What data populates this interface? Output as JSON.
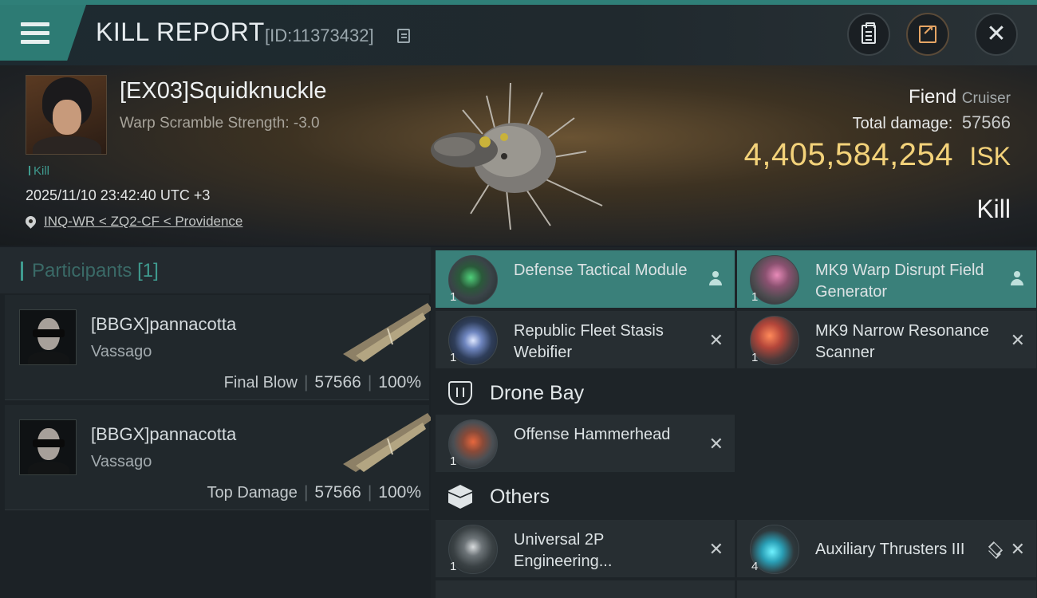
{
  "header": {
    "title": "KILL REPORT",
    "report_id": "[ID:11373432]"
  },
  "victim": {
    "name": "[EX03]Squidknuckle",
    "warp_scramble": "Warp Scramble Strength: -3.0",
    "kill_tag": "Kill",
    "timestamp": "2025/11/10 23:42:40 UTC +3",
    "location": "INQ-WR < ZQ2-CF < Providence",
    "ship_name": "Fiend",
    "ship_class": "Cruiser",
    "total_damage_label": "Total damage:",
    "total_damage": "57566",
    "isk_value": "4,405,584,254",
    "isk_unit": "ISK",
    "result": "Kill"
  },
  "participants": {
    "label": "Participants",
    "count": "[1]",
    "rows": [
      {
        "name": "[BBGX]pannacotta",
        "ship": "Vassago",
        "role": "Final Blow",
        "damage": "57566",
        "percent": "100%"
      },
      {
        "name": "[BBGX]pannacotta",
        "ship": "Vassago",
        "role": "Top Damage",
        "damage": "57566",
        "percent": "100%"
      }
    ]
  },
  "items": {
    "modules": [
      {
        "qty": "1",
        "name": "Defense Tactical Module",
        "state": "highlighted",
        "action_icon": "person-icon"
      },
      {
        "qty": "1",
        "name": "MK9 Warp Disrupt Field Generator",
        "state": "highlighted",
        "action_icon": "person-icon"
      },
      {
        "qty": "1",
        "name": "Republic Fleet Stasis Webifier",
        "state": "destroyed",
        "action_icon": "close-icon"
      },
      {
        "qty": "1",
        "name": "MK9 Narrow Resonance Scanner",
        "state": "destroyed",
        "action_icon": "close-icon"
      }
    ],
    "drone_bay": {
      "label": "Drone Bay",
      "entries": [
        {
          "qty": "1",
          "name": "Offense Hammerhead",
          "state": "destroyed",
          "action_icon": "close-icon"
        }
      ]
    },
    "others": {
      "label": "Others",
      "entries": [
        {
          "qty": "1",
          "name": "Universal 2P Engineering...",
          "state": "destroyed",
          "action_icon": "close-icon"
        },
        {
          "qty": "4",
          "name": "Auxiliary Thrusters III",
          "state": "destroyed",
          "action_icon": "close-icon"
        }
      ]
    }
  },
  "icons": {
    "actions": "close-icon",
    "dropped": "person-icon",
    "stack": "stack-icon"
  },
  "colors": {
    "accent_teal": "#3a807a",
    "isk_gold": "#f3d27a",
    "header_teal": "#2d7b74"
  }
}
